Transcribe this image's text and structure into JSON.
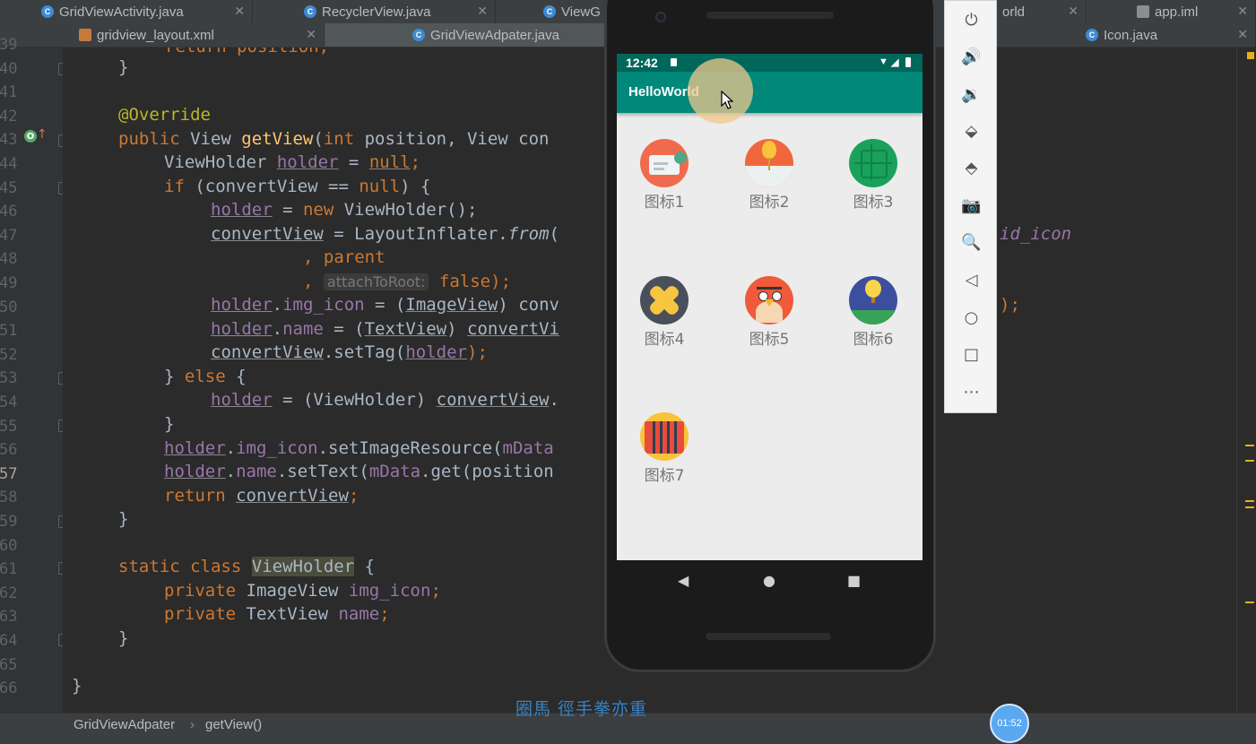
{
  "tabs_row1": [
    {
      "label": "GridViewActivity.java",
      "type": "java"
    },
    {
      "label": "RecyclerView.java",
      "type": "java"
    },
    {
      "label": "ViewG",
      "type": "java"
    },
    {
      "label": "orld",
      "type": "text"
    },
    {
      "label": "app.iml",
      "type": "iml"
    }
  ],
  "tabs_row2": [
    {
      "label": "gridview_layout.xml",
      "type": "xml"
    },
    {
      "label": "GridViewAdpater.java",
      "type": "java",
      "active": true
    },
    {
      "label": "Icon.java",
      "type": "java"
    }
  ],
  "line_numbers": [
    "39",
    "40",
    "41",
    "42",
    "43",
    "44",
    "45",
    "46",
    "47",
    "48",
    "49",
    "50",
    "51",
    "52",
    "53",
    "54",
    "55",
    "56",
    "57",
    "58",
    "59",
    "60",
    "61",
    "62",
    "63",
    "64",
    "65",
    "66"
  ],
  "code": {
    "l0": "return position;",
    "l39": "}",
    "l41_ann": "@Override",
    "l42": {
      "kw1": "public",
      "t1": " View ",
      "fn": "getView",
      "t2": "(",
      "kw2": "int",
      "t3": " position, View con"
    },
    "l43": {
      "t1": "ViewHolder ",
      "v1": "holder",
      "t2": " = ",
      "kw": "null",
      "t3": ";"
    },
    "l44": {
      "kw1": "if",
      "t1": " (convertView == ",
      "kw2": "null",
      "t2": ") {"
    },
    "l45": {
      "v1": "holder",
      "t1": " = ",
      "kw": "new",
      "t2": " ViewHolder();"
    },
    "l46": {
      "v1": "convertView",
      "t1": " = LayoutInflater.",
      "fn": "from",
      "t2": "(",
      "right": "id_icon"
    },
    "l47": ", parent",
    "l48": {
      "t1": ", ",
      "hint": "attachToRoot:",
      "kw": "false",
      "t2": ");"
    },
    "l49": {
      "v1": "holder",
      "t1": ".",
      "f1": "img_icon",
      "t2": " = (",
      "v2": "ImageView",
      "t3": ") conv",
      "right": ");"
    },
    "l50": {
      "v1": "holder",
      "t1": ".",
      "f1": "name",
      "t2": " = (",
      "v2": "TextView",
      "t3": ") ",
      "v3": "convertVi"
    },
    "l51": {
      "v1": "convertView",
      "t1": ".setTag(",
      "v2": "holder",
      "t2": ");"
    },
    "l52": {
      "t1": "} ",
      "kw": "else",
      "t2": " {"
    },
    "l53": {
      "v1": "holder",
      "t1": " = (ViewHolder) ",
      "v2": "convertView",
      "t2": "."
    },
    "l54": "}",
    "l55": {
      "v1": "holder",
      "t1": ".",
      "f1": "img_icon",
      "t2": ".setImageResource(",
      "f2": "mData"
    },
    "l56": {
      "v1": "holder",
      "t1": ".",
      "f1": "name",
      "t2": ".setText(",
      "f2": "mData",
      "t3": ".get(position"
    },
    "l57": {
      "kw": "return",
      "t1": " ",
      "v1": "convertView",
      "t2": ";"
    },
    "l58": "}",
    "l60": {
      "kw1": "static",
      "t1": " ",
      "kw2": "class",
      "t2": " ",
      "hl": "ViewHolder",
      "t3": " {"
    },
    "l61": {
      "kw": "private",
      "t1": " ImageView ",
      "f1": "img_icon",
      "t2": ";"
    },
    "l62": {
      "kw": "private",
      "t1": " TextView ",
      "f1": "name",
      "t2": ";"
    },
    "l63": "}",
    "l65": "}"
  },
  "breadcrumb": {
    "class": "GridViewAdpater",
    "sep": "›",
    "method": "getView()"
  },
  "subtitle": "圈馬 徑手拳亦重",
  "timer": "01:52",
  "emulator": {
    "time": "12:42",
    "app_title": "HelloWorld",
    "items": [
      {
        "label": "图标1",
        "icon": "id-card-icon"
      },
      {
        "label": "图标2",
        "icon": "balloon-icon"
      },
      {
        "label": "图标3",
        "icon": "circuit-icon"
      },
      {
        "label": "图标4",
        "icon": "bandage-icon"
      },
      {
        "label": "图标5",
        "icon": "angry-bird-icon"
      },
      {
        "label": "图标6",
        "icon": "hot-air-balloon-icon"
      },
      {
        "label": "图标7",
        "icon": "accordion-icon"
      }
    ],
    "nav": {
      "back": "◀",
      "home": "●",
      "recents": "■"
    }
  },
  "side_tools": [
    "power-icon",
    "volume-up-icon",
    "volume-down-icon",
    "rotate-left-icon",
    "rotate-right-icon",
    "camera-icon",
    "zoom-icon",
    "back-icon",
    "home-icon",
    "overview-icon",
    "more-icon"
  ],
  "colors": {
    "accent": "#00897b",
    "status": "#00675b",
    "editor_bg": "#2b2b2b"
  }
}
